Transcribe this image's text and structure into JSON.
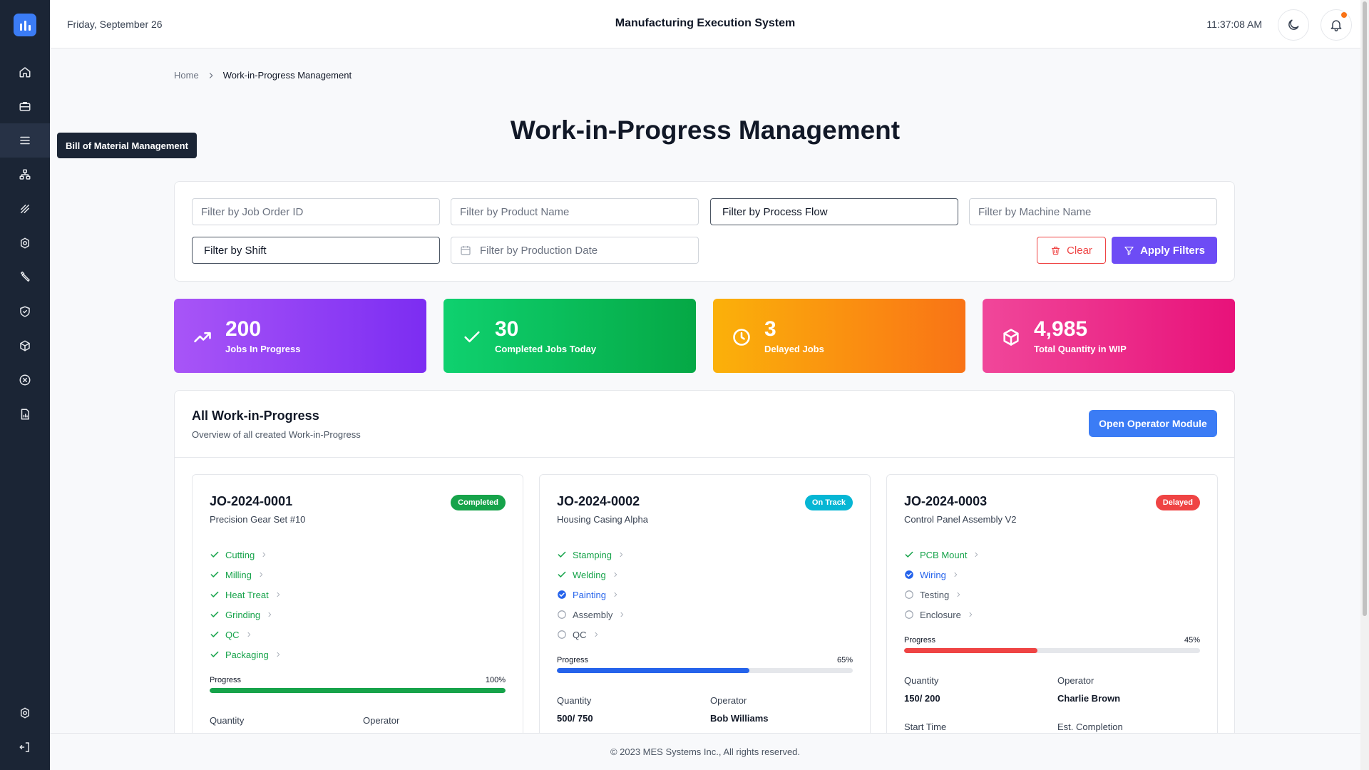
{
  "header": {
    "date": "Friday, September 26",
    "app_title": "Manufacturing Execution System",
    "time": "11:37:08 AM"
  },
  "sidebar": {
    "items": [
      {
        "icon": "home-icon"
      },
      {
        "icon": "briefcase-icon"
      },
      {
        "icon": "list-icon"
      },
      {
        "icon": "hierarchy-icon"
      },
      {
        "icon": "percent-icon"
      },
      {
        "icon": "settings-icon"
      },
      {
        "icon": "wrench-icon"
      },
      {
        "icon": "shield-icon"
      },
      {
        "icon": "cube-icon"
      },
      {
        "icon": "x-circle-icon"
      },
      {
        "icon": "report-icon"
      }
    ],
    "bottom": [
      {
        "icon": "gear-icon"
      },
      {
        "icon": "logout-icon"
      }
    ],
    "tooltip": "Bill of Material Management"
  },
  "breadcrumb": {
    "home": "Home",
    "current": "Work-in-Progress Management"
  },
  "page_title": "Work-in-Progress Management",
  "filters": {
    "job_order_placeholder": "Filter by Job Order ID",
    "product_placeholder": "Filter by Product Name",
    "process_flow": "Filter by Process Flow",
    "machine_placeholder": "Filter by Machine Name",
    "shift": "Filter by Shift",
    "date_placeholder": "Filter by Production Date",
    "clear_label": "Clear",
    "apply_label": "Apply Filters"
  },
  "stats": [
    {
      "value": "200",
      "label": "Jobs In Progress"
    },
    {
      "value": "30",
      "label": "Completed Jobs Today"
    },
    {
      "value": "3",
      "label": "Delayed Jobs"
    },
    {
      "value": "4,985",
      "label": "Total Quantity in WIP"
    }
  ],
  "colors": {
    "accent": "#6d4cf5",
    "primary_blue": "#3b7cf5",
    "completed": "#16a34a",
    "on_track": "#06b6d4",
    "delayed": "#ef4444"
  },
  "wip": {
    "title": "All Work-in-Progress",
    "subtitle": "Overview of all created Work-in-Progress",
    "operator_button": "Open Operator Module",
    "progress_label": "Progress",
    "quantity_label": "Quantity",
    "operator_label": "Operator",
    "start_time_label": "Start Time",
    "est_completion_label": "Est. Completion",
    "cards": [
      {
        "job_id": "JO-2024-0001",
        "product": "Precision Gear Set #10",
        "status": "Completed",
        "steps": [
          {
            "name": "Cutting",
            "state": "done"
          },
          {
            "name": "Milling",
            "state": "done"
          },
          {
            "name": "Heat Treat",
            "state": "done"
          },
          {
            "name": "Grinding",
            "state": "done"
          },
          {
            "name": "QC",
            "state": "done"
          },
          {
            "name": "Packaging",
            "state": "done"
          }
        ],
        "progress_text": "100%",
        "progress": 1.0,
        "quantity": "",
        "operator": ""
      },
      {
        "job_id": "JO-2024-0002",
        "product": "Housing Casing Alpha",
        "status": "On Track",
        "steps": [
          {
            "name": "Stamping",
            "state": "done"
          },
          {
            "name": "Welding",
            "state": "done"
          },
          {
            "name": "Painting",
            "state": "current"
          },
          {
            "name": "Assembly",
            "state": "todo"
          },
          {
            "name": "QC",
            "state": "todo"
          }
        ],
        "progress_text": "65%",
        "progress": 0.65,
        "quantity": "500/ 750",
        "operator": "Bob Williams"
      },
      {
        "job_id": "JO-2024-0003",
        "product": "Control Panel Assembly V2",
        "status": "Delayed",
        "steps": [
          {
            "name": "PCB Mount",
            "state": "done"
          },
          {
            "name": "Wiring",
            "state": "current"
          },
          {
            "name": "Testing",
            "state": "todo"
          },
          {
            "name": "Enclosure",
            "state": "todo"
          }
        ],
        "progress_text": "45%",
        "progress": 0.45,
        "quantity": "150/ 200",
        "operator": "Charlie Brown"
      }
    ]
  },
  "footer": "© 2023 MES Systems Inc., All rights reserved."
}
